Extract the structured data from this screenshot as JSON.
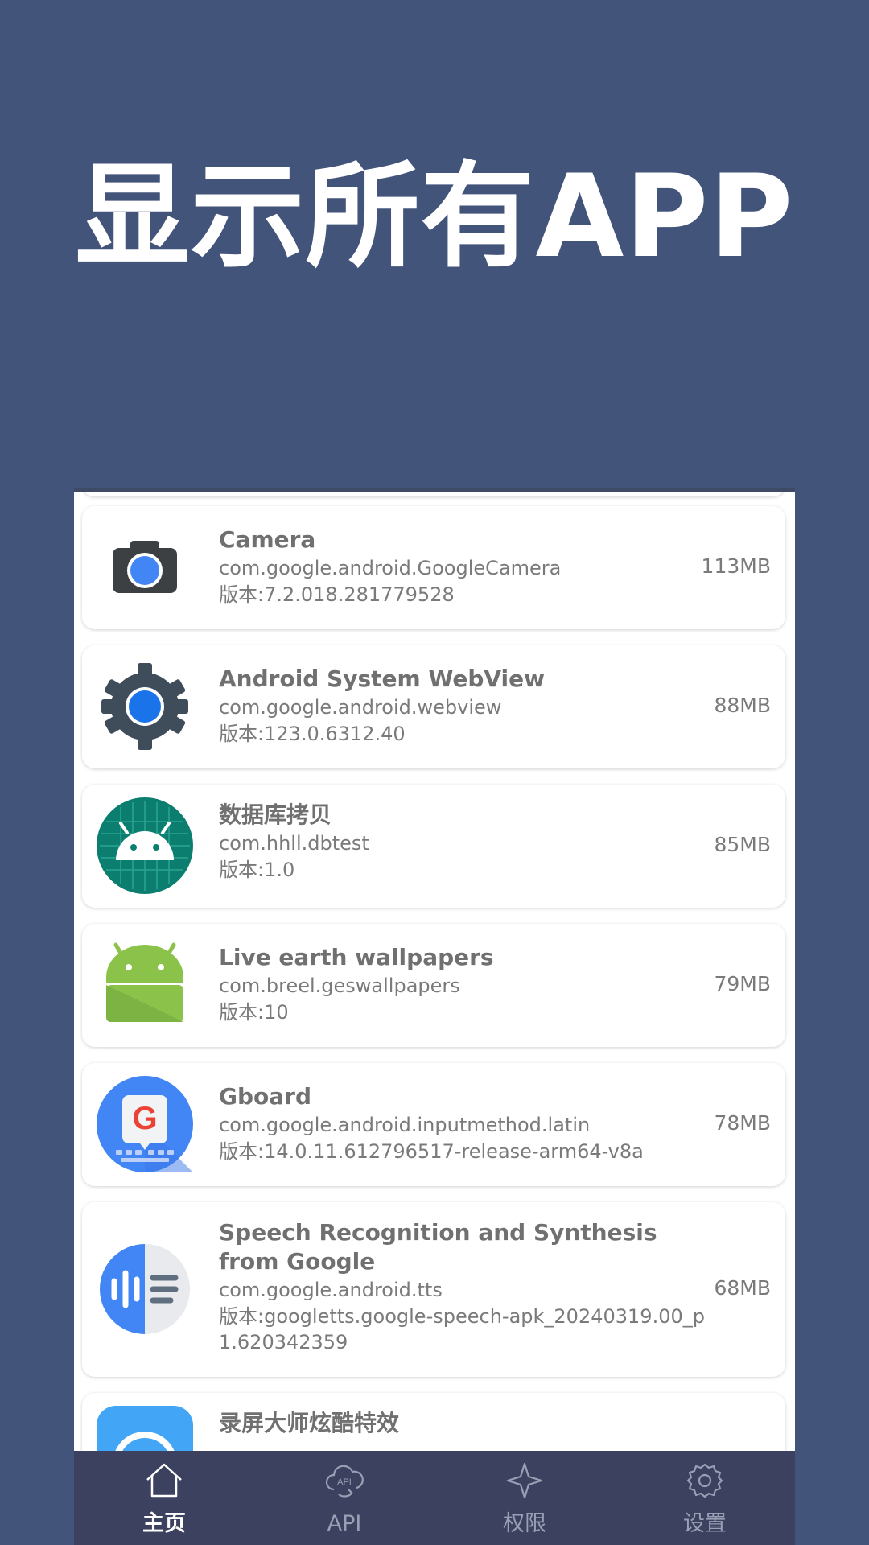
{
  "headline": "显示所有APP",
  "apps": [
    {
      "name": "Camera",
      "package": "com.google.android.GoogleCamera",
      "version": "版本:7.2.018.281779528",
      "size": "113MB",
      "icon": "camera-icon"
    },
    {
      "name": "Android System WebView",
      "package": "com.google.android.webview",
      "version": "版本:123.0.6312.40",
      "size": "88MB",
      "icon": "webview-gear-icon"
    },
    {
      "name": "数据库拷贝",
      "package": "com.hhll.dbtest",
      "version": "版本:1.0",
      "size": "85MB",
      "icon": "android-grid-icon"
    },
    {
      "name": "Live earth wallpapers",
      "package": "com.breel.geswallpapers",
      "version": "版本:10",
      "size": "79MB",
      "icon": "android-robot-icon"
    },
    {
      "name": "Gboard",
      "package": "com.google.android.inputmethod.latin",
      "version": "版本:14.0.11.612796517-release-arm64-v8a",
      "size": "78MB",
      "icon": "gboard-icon"
    },
    {
      "name": "Speech Recognition and Synthesis from Google",
      "package": "com.google.android.tts",
      "version": "版本:googletts.google-speech-apk_20240319.00_p1.620342359",
      "size": "68MB",
      "icon": "speech-icon"
    },
    {
      "name": "录屏大师炫酷特效",
      "package": "",
      "version": "",
      "size": "",
      "icon": "screen-recorder-icon"
    }
  ],
  "nav": [
    {
      "label": "主页",
      "icon": "home-icon",
      "active": true
    },
    {
      "label": "API",
      "icon": "api-cloud-icon",
      "active": false
    },
    {
      "label": "权限",
      "icon": "sparkle-icon",
      "active": false
    },
    {
      "label": "设置",
      "icon": "settings-gear-icon",
      "active": false
    }
  ],
  "colors": {
    "background": "#43547a",
    "navbar": "#3c4160",
    "nav_active": "#ffffff",
    "nav_inactive": "#9a9fb3"
  }
}
